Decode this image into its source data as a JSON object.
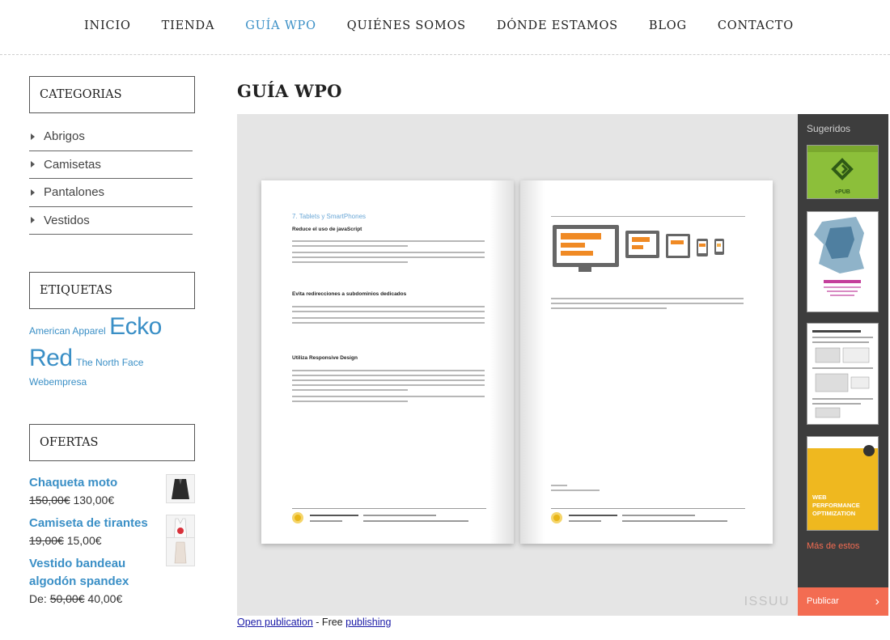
{
  "nav": {
    "items": [
      {
        "label": "INICIO",
        "active": false
      },
      {
        "label": "TIENDA",
        "active": false
      },
      {
        "label": "GUÍA WPO",
        "active": true
      },
      {
        "label": "QUIÉNES SOMOS",
        "active": false
      },
      {
        "label": "DÓNDE ESTAMOS",
        "active": false
      },
      {
        "label": "BLOG",
        "active": false
      },
      {
        "label": "CONTACTO",
        "active": false
      }
    ]
  },
  "sidebar": {
    "categories_title": "CATEGORIAS",
    "categories": [
      "Abrigos",
      "Camisetas",
      "Pantalones",
      "Vestidos"
    ],
    "tags_title": "ETIQUETAS",
    "tags": [
      {
        "label": "American Apparel",
        "size": "sm"
      },
      {
        "label": "Ecko Red",
        "size": "lg"
      },
      {
        "label": "The North Face",
        "size": "sm"
      },
      {
        "label": "Webempresa",
        "size": "sm"
      }
    ],
    "offers_title": "OFERTAS",
    "offers": [
      {
        "title": "Chaqueta moto",
        "prefix": "",
        "old_price": "150,00€",
        "new_price": "130,00€"
      },
      {
        "title": "Camiseta de tirantes",
        "prefix": "",
        "old_price": "19,00€",
        "new_price": "15,00€"
      },
      {
        "title": "Vestido bandeau algodón spandex",
        "prefix": "De: ",
        "old_price": "50,00€",
        "new_price": "40,00€"
      }
    ]
  },
  "main": {
    "title": "GUÍA WPO",
    "viewer": {
      "left_page": {
        "chapter": "7. Tablets y SmartPhones",
        "headings": [
          "Reduce el uso de javaScript",
          "Evita redirecciones a subdominios dedicados",
          "Utiliza Responsive Design"
        ],
        "footer_brand": "MetricSpot Executive Guides"
      },
      "right_page": {
        "footer_brand": "MetricSpot Executive Guides"
      },
      "brand": "ISSUU"
    },
    "suggestions": {
      "title": "Sugeridos",
      "more_label": "Más de estos",
      "publish_label": "Publicar",
      "thumb_epub_text": "ePUB",
      "thumb_wpo_text": "WEB PERFORMANCE OPTIMIZATION"
    },
    "below": {
      "open_label": "Open publication",
      "separator": " - Free ",
      "publishing_label": "publishing"
    }
  },
  "colors": {
    "accent": "#3a8fc6",
    "publish": "#f36c52",
    "devices": "#f08a24"
  }
}
